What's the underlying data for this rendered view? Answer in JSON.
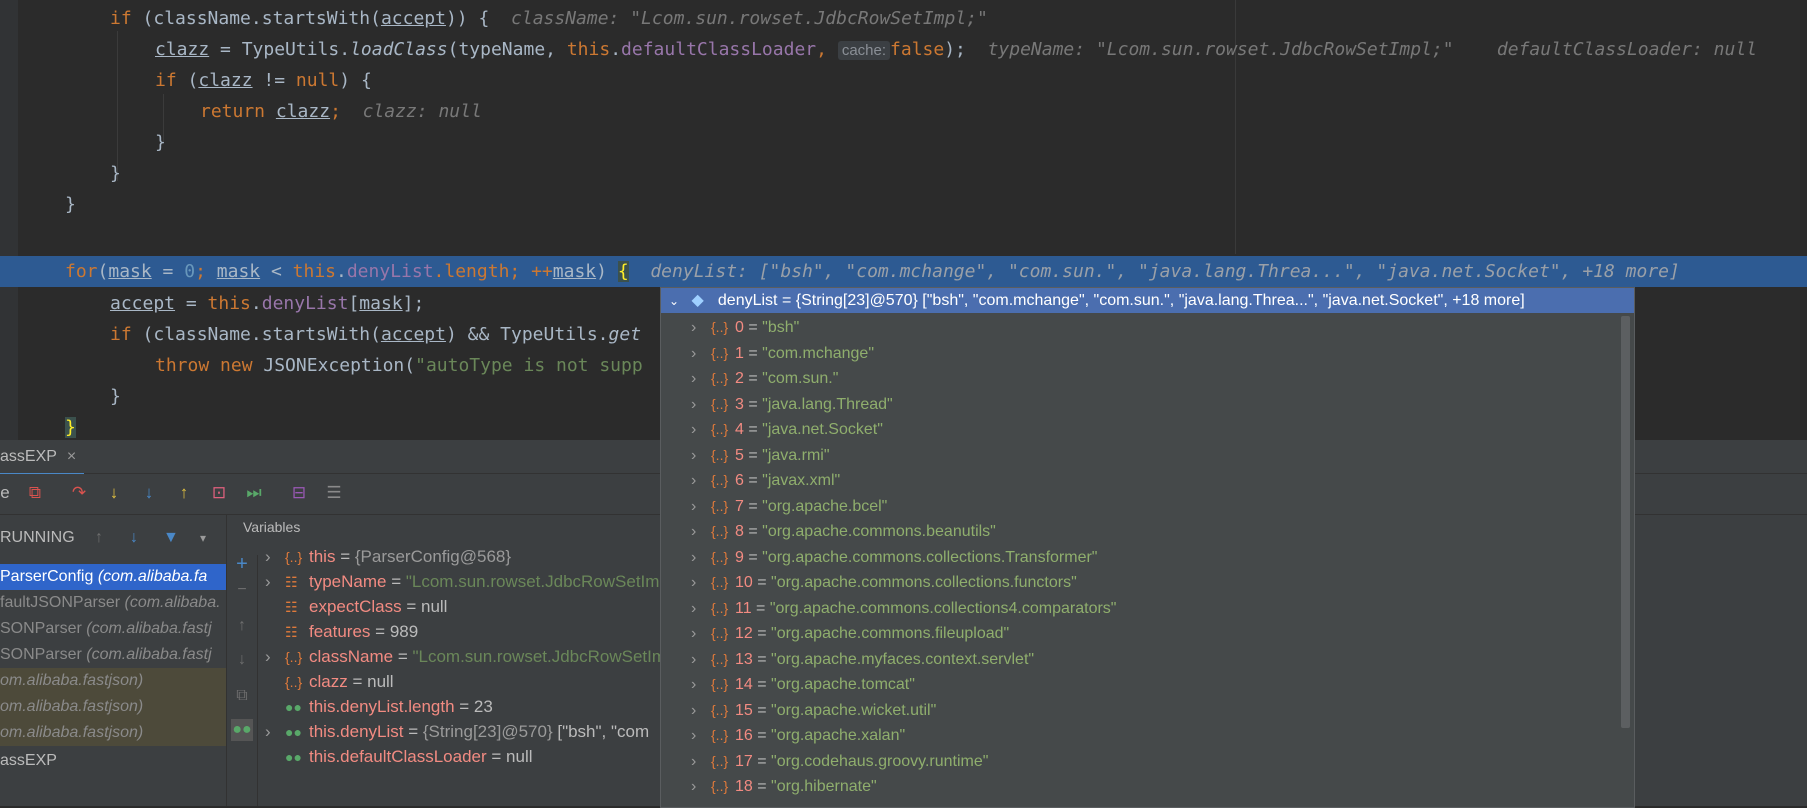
{
  "editor": {
    "line1": {
      "kw": "if",
      "a": " (className.startsWith(",
      "var": "accept",
      "b": ")) {",
      "hint": "className: \"Lcom.sun.rowset.JdbcRowSetImpl;\""
    },
    "line2": {
      "var": "clazz",
      "a": " = TypeUtils.",
      "method": "loadClass",
      "b": "(typeName, ",
      "kw": "this",
      "c": ".",
      "fld": "defaultClassLoader",
      "d": ", ",
      "param": "cache:",
      "kw2": "false",
      "e": ");",
      "hint": "typeName: \"Lcom.sun.rowset.JdbcRowSetImpl;\"    defaultClassLoader: null"
    },
    "line3": {
      "kw": "if",
      "a": " (",
      "var": "clazz",
      "b": " != ",
      "kw2": "null",
      "c": ") {"
    },
    "line4": {
      "kw": "return",
      "a": " ",
      "var": "clazz",
      "b": ";",
      "hint": "clazz: null"
    },
    "line5": {
      "a": "}"
    },
    "line6": {
      "a": "}"
    },
    "line7": {
      "a": "}"
    },
    "line9": {
      "kw": "for",
      "a": "(",
      "v1": "mask",
      "b": " = ",
      "num": "0",
      "c": "; ",
      "v2": "mask",
      "d": " < ",
      "kw2": "this",
      "e": ".",
      "fld": "denyList",
      "f": ".length; ++",
      "v3": "mask",
      "g": ") ",
      "brace": "{",
      "hint": "denyList: [\"bsh\", \"com.mchange\", \"com.sun.\", \"java.lang.Threa...\", \"java.net.Socket\", +18 more]"
    },
    "line10": {
      "var": "accept",
      "a": " = ",
      "kw": "this",
      "b": ".",
      "fld": "denyList",
      "c": "[",
      "v2": "mask",
      "d": "];"
    },
    "line11": {
      "kw": "if",
      "a": " (className.startsWith(",
      "var": "accept",
      "b": ") && TypeUtils.",
      "method": "get"
    },
    "line12": {
      "kw": "throw",
      "a": " ",
      "kw2": "new",
      "b": " JSONException(",
      "str": "\"autoType is not supp"
    },
    "line13": {
      "a": "}"
    },
    "line14": {
      "a": "}"
    }
  },
  "debug": {
    "tab_label": "assEXP",
    "tab_close": "×",
    "toolbar_left": "e",
    "running_label": "RUNNING",
    "variables_header": "Variables",
    "frames": [
      {
        "name": "ParserConfig ",
        "pkg": "(com.alibaba.fa"
      },
      {
        "name": "faultJSONParser ",
        "pkg": "(com.alibaba."
      },
      {
        "name": "SONParser ",
        "pkg": "(com.alibaba.fastj"
      },
      {
        "name": "SONParser ",
        "pkg": "(com.alibaba.fastj"
      },
      {
        "name": "",
        "pkg": "om.alibaba.fastjson)"
      },
      {
        "name": "",
        "pkg": "om.alibaba.fastjson)"
      },
      {
        "name": "",
        "pkg": "om.alibaba.fastjson)"
      },
      {
        "name": "assEXP",
        "pkg": ""
      }
    ],
    "variables": [
      {
        "name": "this",
        "eq": " = ",
        "ref": "{ParserConfig@568}",
        "val": ""
      },
      {
        "name": "typeName",
        "eq": " = ",
        "ref": "",
        "val": "\"Lcom.sun.rowset.JdbcRowSetIm"
      },
      {
        "name": "expectClass",
        "eq": " = ",
        "ref": "",
        "val": "null"
      },
      {
        "name": "features",
        "eq": " = ",
        "ref": "",
        "val": "989"
      },
      {
        "name": "className",
        "eq": " = ",
        "ref": "",
        "val": "\"Lcom.sun.rowset.JdbcRowSetIm"
      },
      {
        "name": "clazz",
        "eq": " = ",
        "ref": "",
        "val": "null"
      },
      {
        "name": "this.denyList.length",
        "eq": " = ",
        "ref": "",
        "val": "23"
      },
      {
        "name": "this.denyList",
        "eq": " = ",
        "ref": "{String[23]@570} ",
        "val": "[\"bsh\", \"com"
      },
      {
        "name": "this.defaultClassLoader",
        "eq": " = ",
        "ref": "",
        "val": "null"
      }
    ]
  },
  "popup": {
    "header": "denyList = {String[23]@570} [\"bsh\", \"com.mchange\", \"com.sun.\", \"java.lang.Threa...\", \"java.net.Socket\", +18 more]",
    "items": [
      {
        "idx": "0",
        "val": "\"bsh\""
      },
      {
        "idx": "1",
        "val": "\"com.mchange\""
      },
      {
        "idx": "2",
        "val": "\"com.sun.\""
      },
      {
        "idx": "3",
        "val": "\"java.lang.Thread\""
      },
      {
        "idx": "4",
        "val": "\"java.net.Socket\""
      },
      {
        "idx": "5",
        "val": "\"java.rmi\""
      },
      {
        "idx": "6",
        "val": "\"javax.xml\""
      },
      {
        "idx": "7",
        "val": "\"org.apache.bcel\""
      },
      {
        "idx": "8",
        "val": "\"org.apache.commons.beanutils\""
      },
      {
        "idx": "9",
        "val": "\"org.apache.commons.collections.Transformer\""
      },
      {
        "idx": "10",
        "val": "\"org.apache.commons.collections.functors\""
      },
      {
        "idx": "11",
        "val": "\"org.apache.commons.collections4.comparators\""
      },
      {
        "idx": "12",
        "val": "\"org.apache.commons.fileupload\""
      },
      {
        "idx": "13",
        "val": "\"org.apache.myfaces.context.servlet\""
      },
      {
        "idx": "14",
        "val": "\"org.apache.tomcat\""
      },
      {
        "idx": "15",
        "val": "\"org.apache.wicket.util\""
      },
      {
        "idx": "16",
        "val": "\"org.apache.xalan\""
      },
      {
        "idx": "17",
        "val": "\"org.codehaus.groovy.runtime\""
      },
      {
        "idx": "18",
        "val": "\"org.hibernate\""
      }
    ]
  },
  "colors": {
    "highlight": "#2d5a92",
    "popup_header": "#4b6eaf",
    "selected_frame": "#2f65ca"
  }
}
